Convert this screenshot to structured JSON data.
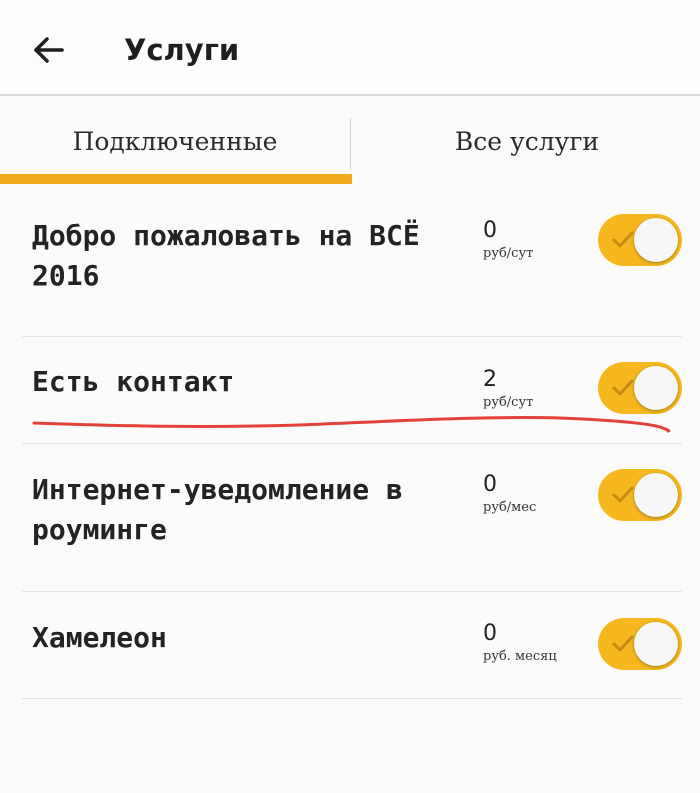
{
  "header": {
    "title": "Услуги"
  },
  "tabs": [
    {
      "label": "Подключенные",
      "active": true
    },
    {
      "label": "Все услуги",
      "active": false
    }
  ],
  "services": [
    {
      "name_line1": "Добро пожаловать на ВСЁ",
      "name_line2": "2016",
      "price": "0",
      "unit": "руб/сут",
      "enabled": true
    },
    {
      "name_line1": "Есть контакт",
      "name_line2": "",
      "price": "2",
      "unit": "руб/сут",
      "enabled": true
    },
    {
      "name_line1": "Интернет-уведомление в",
      "name_line2": "роуминге",
      "price": "0",
      "unit": "руб/мес",
      "enabled": true
    },
    {
      "name_line1": "Хамелеон",
      "name_line2": "",
      "price": "0",
      "unit": "руб. месяц",
      "enabled": true
    }
  ],
  "colors": {
    "accent": "#f2aa1a",
    "toggle_on": "#f6b81e",
    "annotation_red": "#e0423a"
  },
  "icons": {
    "back": "arrow-left-icon",
    "check": "check-icon"
  }
}
